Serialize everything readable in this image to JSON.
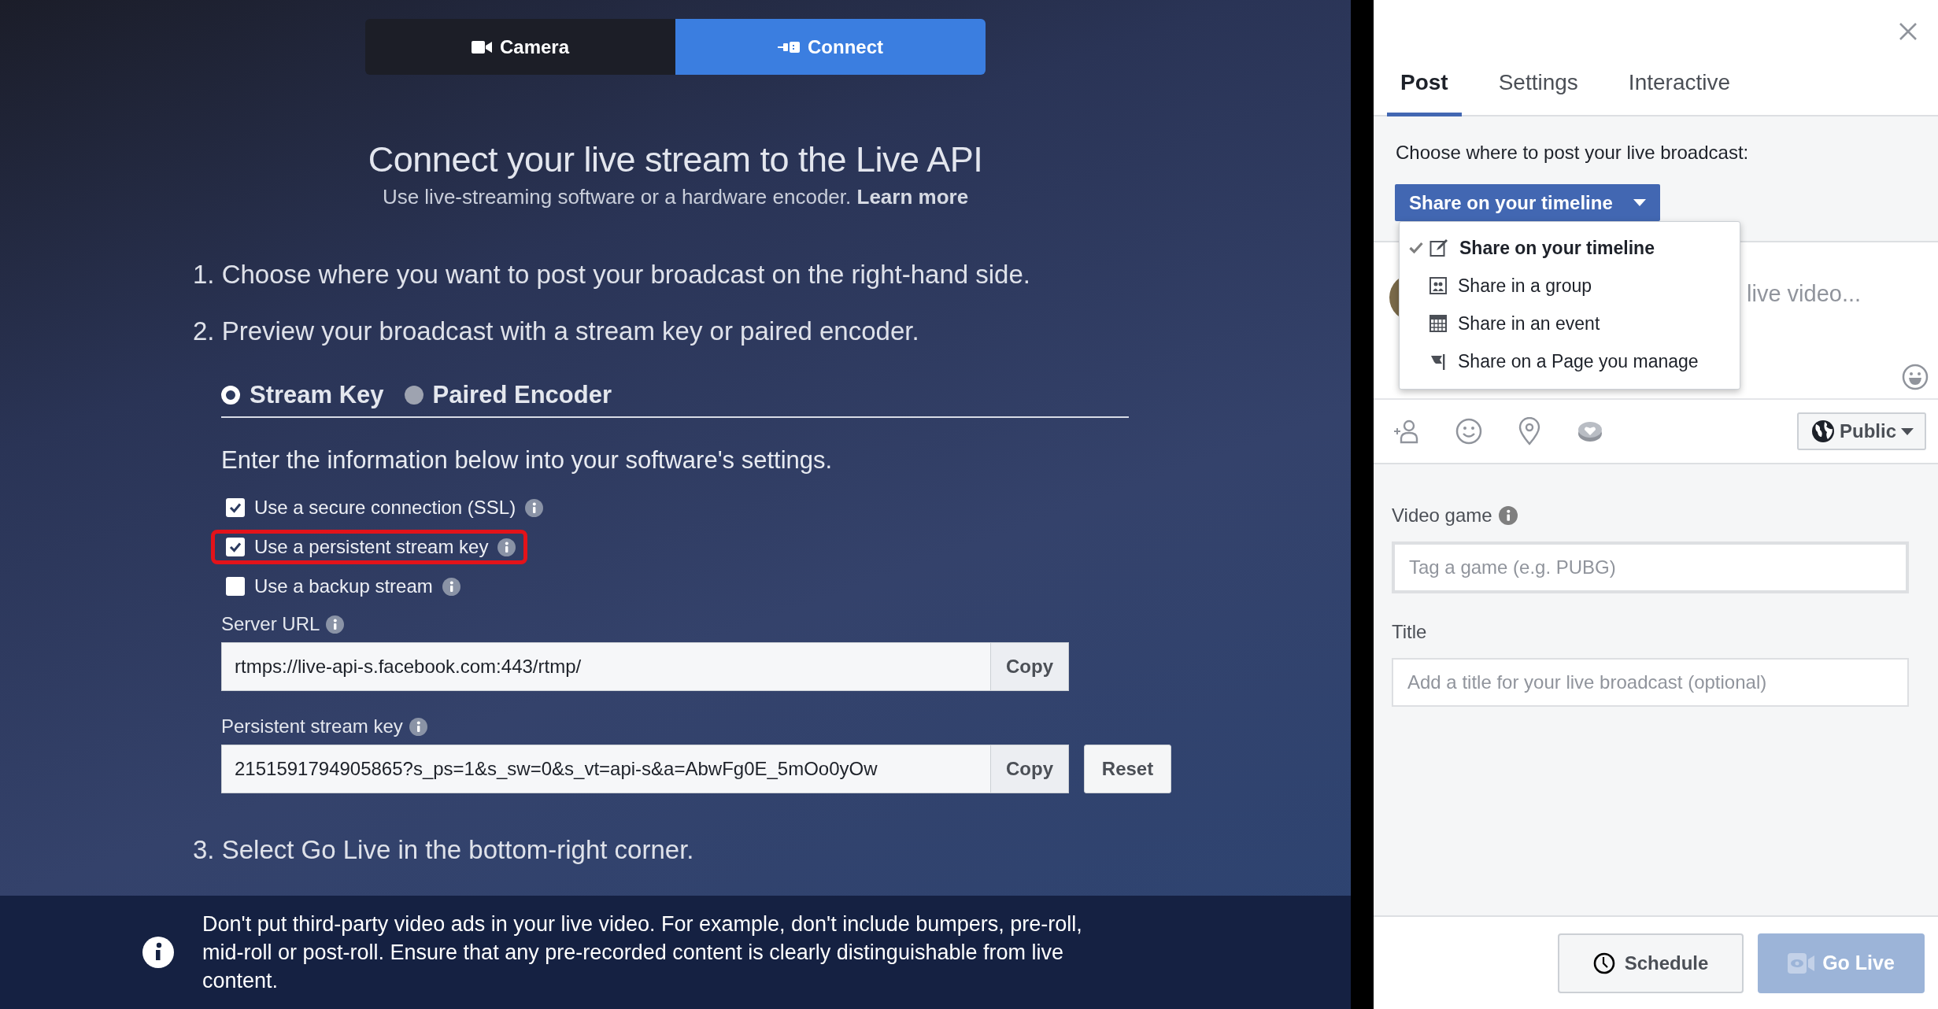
{
  "source_tabs": [
    {
      "label": "Camera",
      "kind": "camera",
      "selected": false
    },
    {
      "label": "Connect",
      "kind": "connect",
      "selected": true
    }
  ],
  "heading": "Connect your live stream to the Live API",
  "subtitle": {
    "text": "Use live-streaming software or a hardware encoder.",
    "link": "Learn more"
  },
  "steps": [
    "1. Choose where you want to post your broadcast on the right-hand side.",
    "2. Preview your broadcast with a stream key or paired encoder."
  ],
  "modes": [
    {
      "label": "Stream Key",
      "selected": true
    },
    {
      "label": "Paired Encoder",
      "selected": false
    }
  ],
  "instructions": "Enter the information below into your software's settings.",
  "options": [
    {
      "label": "Use a secure connection (SSL)",
      "checked": true,
      "highlighted": false
    },
    {
      "label": "Use a persistent stream key",
      "checked": true,
      "highlighted": true
    },
    {
      "label": "Use a backup stream",
      "checked": false,
      "highlighted": false
    }
  ],
  "server_url": {
    "label": "Server URL",
    "value": "rtmps://live-api-s.facebook.com:443/rtmp/",
    "copy": "Copy"
  },
  "stream_key": {
    "label": "Persistent stream key",
    "value": "2151591794905865?s_ps=1&s_sw=0&s_vt=api-s&a=AbwFg0E_5mOo0yOw",
    "copy": "Copy",
    "reset": "Reset"
  },
  "final_step": "3. Select Go Live in the bottom-right corner.",
  "notice": "Don't put third-party video ads in your live video. For example, don't include bumpers, pre-roll, mid-roll or post-roll. Ensure that any pre-recorded content is clearly distinguishable from live content.",
  "panel": {
    "tabs": [
      {
        "label": "Post",
        "selected": true
      },
      {
        "label": "Settings",
        "selected": false
      },
      {
        "label": "Interactive",
        "selected": false
      }
    ],
    "prompt": "Choose where to post your live broadcast:",
    "destination": "Share on your timeline",
    "menu": [
      {
        "label": "Share on your timeline",
        "kind": "timeline",
        "selected": true
      },
      {
        "label": "Share in a group",
        "kind": "group",
        "selected": false
      },
      {
        "label": "Share in an event",
        "kind": "event",
        "selected": false
      },
      {
        "label": "Share on a Page you manage",
        "kind": "page",
        "selected": false
      }
    ],
    "composer_placeholder": "live video...",
    "audience": "Public",
    "video_game": {
      "label": "Video game",
      "placeholder": "Tag a game (e.g. PUBG)"
    },
    "title": {
      "label": "Title",
      "placeholder": "Add a title for your live broadcast (optional)"
    },
    "schedule": "Schedule",
    "go_live": {
      "label": "Go Live",
      "disabled": true
    }
  }
}
